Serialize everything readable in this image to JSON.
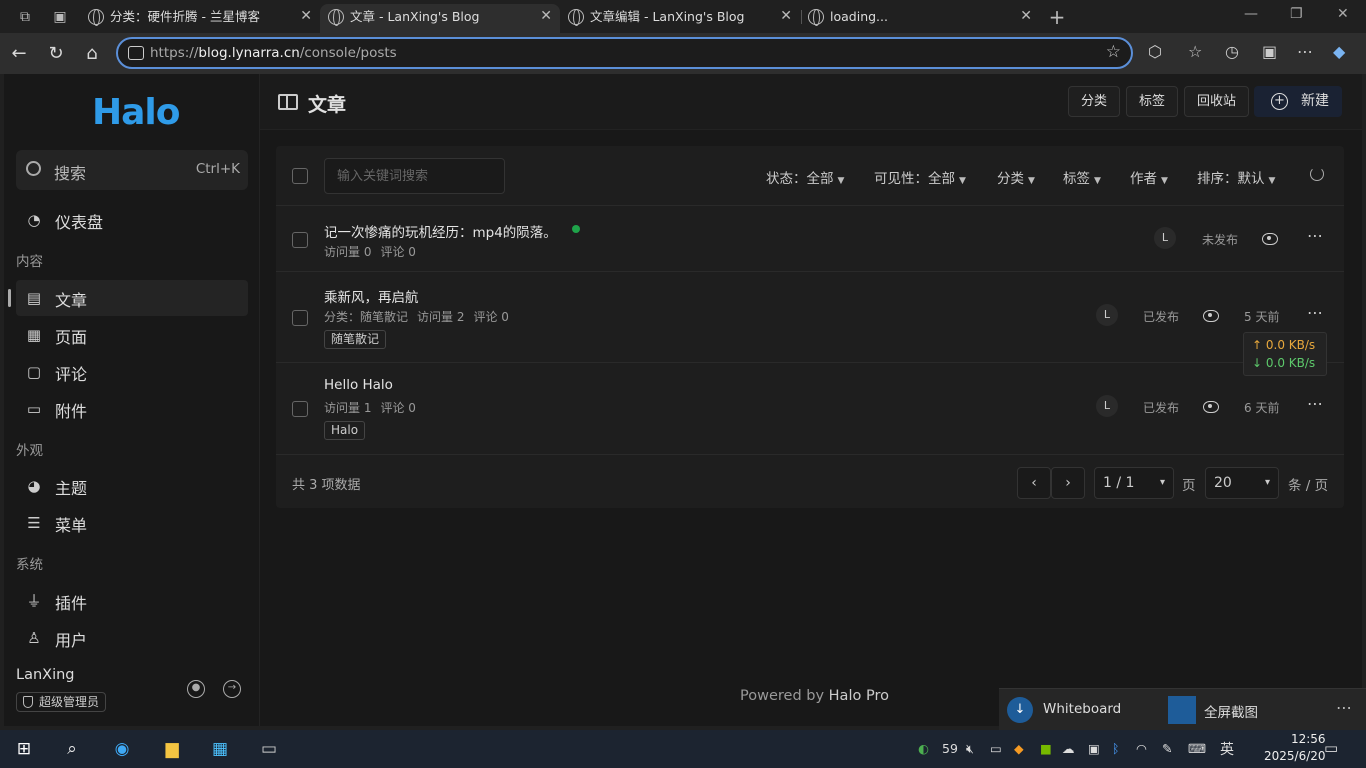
{
  "browser": {
    "tabs": [
      {
        "title": "分类：硬件折腾 - 兰星博客"
      },
      {
        "title": "文章 - LanXing's Blog"
      },
      {
        "title": "文章编辑 - LanXing's Blog"
      },
      {
        "title": "loading..."
      }
    ],
    "new_tab": "+",
    "url_prefix": "https://",
    "url_host": "blog.lynarra.cn",
    "url_path": "/console/posts"
  },
  "sidebar": {
    "logo": "Halo",
    "search_label": "搜索",
    "search_shortcut": "Ctrl+K",
    "dashboard": "仪表盘",
    "group_content": "内容",
    "posts": "文章",
    "pages": "页面",
    "comments": "评论",
    "attachments": "附件",
    "group_appearance": "外观",
    "themes": "主题",
    "menus": "菜单",
    "group_system": "系统",
    "plugins": "插件",
    "users": "用户",
    "user_name": "LanXing",
    "user_role": "超级管理员"
  },
  "header": {
    "title": "文章",
    "btn_categories": "分类",
    "btn_tags": "标签",
    "btn_recycle": "回收站",
    "btn_new": "新建"
  },
  "toolbar": {
    "search_placeholder": "输入关键词搜索",
    "filters": [
      "状态：全部",
      "可见性：全部",
      "分类",
      "标签",
      "作者",
      "排序：默认"
    ]
  },
  "posts": [
    {
      "title": "记一次惨痛的玩机经历：mp4的陨落。",
      "meta": [
        "访问量 0",
        "评论 0"
      ],
      "tags": [],
      "avatar": "L",
      "status": "未发布",
      "time": ""
    },
    {
      "title": "乘新风，再启航",
      "meta": [
        "分类：",
        "随笔散记",
        "访问量 2",
        "评论 0"
      ],
      "tags": [
        "随笔散记"
      ],
      "avatar": "L",
      "status": "已发布",
      "time": "5 天前"
    },
    {
      "title": "Hello Halo",
      "meta": [
        "访问量 1",
        "评论 0"
      ],
      "tags": [
        "Halo"
      ],
      "avatar": "L",
      "status": "已发布",
      "time": "6 天前"
    }
  ],
  "pagination": {
    "total": "共 3 项数据",
    "page_value": "1 / 1",
    "page_label": "页",
    "size_value": "20",
    "size_label": "条 / 页"
  },
  "netspeed": {
    "up": "↑ 0.0 KB/s",
    "down": "↓ 0.0 KB/s"
  },
  "footer": {
    "powered_prefix": "Powered by ",
    "powered_brand": "Halo Pro"
  },
  "toast": {
    "left": "Whiteboard",
    "right": "全屏截图"
  },
  "taskbar": {
    "ime": "英",
    "time": "12:56",
    "date": "2025/6/20",
    "tray_num": "59"
  },
  "colors": {
    "accent": "#2f9be8",
    "published_dot": "#1fa34a",
    "up": "#e8a83c",
    "down": "#5dc96b"
  }
}
